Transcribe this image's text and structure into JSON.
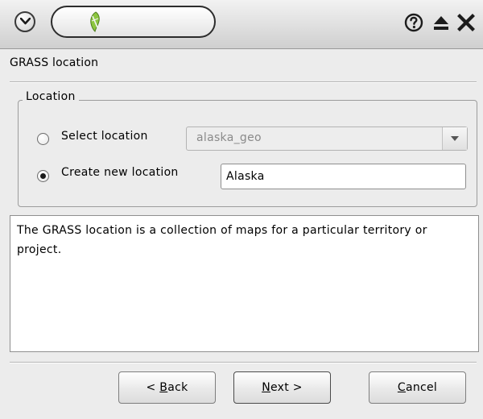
{
  "dialog": {
    "page_title": "GRASS location"
  },
  "location_group": {
    "legend": "Location",
    "select_location": {
      "label": "Select location",
      "selected": false,
      "combo_value": "alaska_geo"
    },
    "create_location": {
      "label": "Create new location",
      "selected": true,
      "input_value": "Alaska"
    }
  },
  "description": {
    "text": "The GRASS location is a collection of maps for a particular territory or project."
  },
  "buttons": {
    "back": {
      "prefix": "< ",
      "mnemonic": "B",
      "rest": "ack"
    },
    "next": {
      "mnemonic": "N",
      "rest": "ext >"
    },
    "cancel": {
      "mnemonic": "C",
      "rest": "ancel"
    }
  },
  "icons": {
    "window_menu": "chevron-down-icon",
    "app": "qgis-icon",
    "help": "help-icon",
    "shade": "shade-icon",
    "close": "close-icon"
  },
  "colors": {
    "window_bg": "#ececec",
    "app_icon_green": "#8cc63f"
  }
}
